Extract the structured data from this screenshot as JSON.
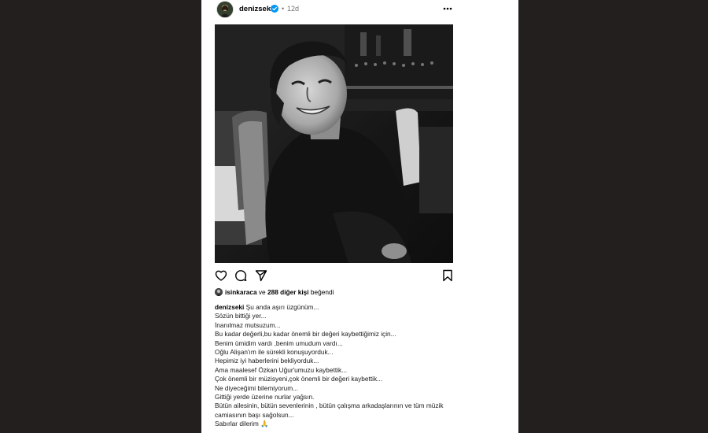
{
  "post": {
    "username": "denizseki",
    "time": "12d",
    "separator": "•",
    "liked_by": {
      "user": "isinkaraca",
      "connector": "ve",
      "others": "288 diğer kişi",
      "suffix": "beğendi"
    },
    "caption_lines": [
      "Şu anda aşırı üzgünüm...",
      "Sözün bittiği yer...",
      "İnanılmaz mutsuzum...",
      "Bu kadar değerli,bu kadar önemli bir değeri kaybettiğimiz için...",
      "Benim ümidim vardı ,benim umudum vardı...",
      "Oğlu Alişan'ım ile sürekli konuşuyorduk...",
      "Hepimiz iyi haberlerini bekliyorduk...",
      "Ama maalesef Özkan Uğur'umuzu kaybettik...",
      "Çok önemli bir müzisyeni,çok önemli bir değeri kaybettik...",
      "Ne diyeceğimi bilemiyorum...",
      "Gittiği yerde üzerine nurlar yağsın.",
      "Bütün ailesinin, bütün sevenlerinin , bütün çalışma arkadaşlarının ve tüm müzik camiasının başı sağolsun...",
      "Sabırlar dilerim 🙏"
    ]
  },
  "icons": {
    "avatar": "profile-avatar",
    "verified": "verified-badge-icon",
    "more": "more-options-icon",
    "like": "heart-icon",
    "comment": "comment-icon",
    "share": "send-icon",
    "save": "bookmark-icon"
  },
  "colors": {
    "page_background": "#221f1e",
    "card_background": "#ffffff",
    "verified_blue": "#0095f6",
    "secondary_text": "#737373"
  }
}
